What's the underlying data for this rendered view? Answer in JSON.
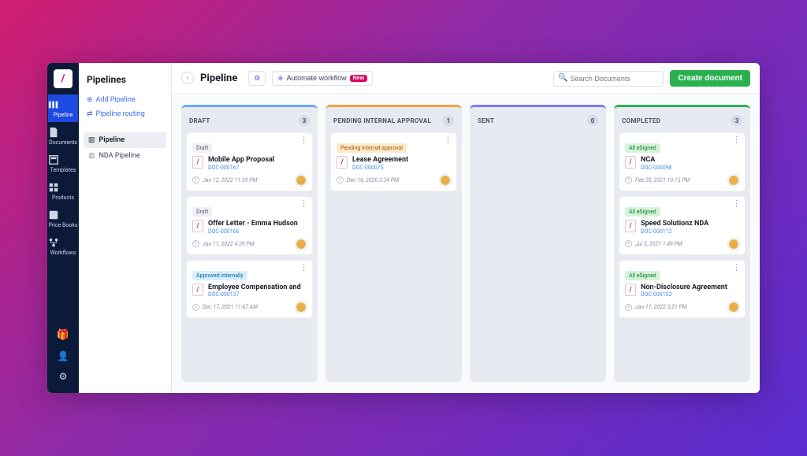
{
  "rail": {
    "items": [
      {
        "name": "pipeline",
        "label": "Pipeline",
        "active": true
      },
      {
        "name": "documents",
        "label": "Documents",
        "active": false
      },
      {
        "name": "templates",
        "label": "Templates",
        "active": false
      },
      {
        "name": "products",
        "label": "Products",
        "active": false
      },
      {
        "name": "pricebooks",
        "label": "Price Books",
        "active": false
      },
      {
        "name": "workflows",
        "label": "Workflows",
        "active": false
      }
    ]
  },
  "sidebar": {
    "title": "Pipelines",
    "links": [
      {
        "label": "Add Pipeline"
      },
      {
        "label": "Pipeline routing"
      }
    ],
    "list": [
      {
        "label": "Pipeline",
        "active": true
      },
      {
        "label": "NDA Pipeline",
        "active": false
      }
    ]
  },
  "topbar": {
    "title": "Pipeline",
    "automate_label": "Automate workflow",
    "new_pill": "New",
    "search_placeholder": "Search Documents",
    "create_label": "Create document"
  },
  "board": {
    "columns": [
      {
        "title": "DRAFT",
        "count": "3",
        "accent": "blue",
        "cards": [
          {
            "badge": "Draft",
            "badgeClass": "draft",
            "title": "Mobile App Proposal",
            "docId": "DOC-000167",
            "time": "Jan 12, 2022 11:39 PM"
          },
          {
            "badge": "Draft",
            "badgeClass": "draft",
            "title": "Offer Letter - Emma Hudson",
            "docId": "DOC-000166",
            "time": "Jan 11, 2022 4:39 PM"
          },
          {
            "badge": "Approved internally",
            "badgeClass": "approved",
            "title": "Employee Compensation and",
            "docId": "DOC-000137",
            "time": "Dec 17, 2021 11:47 AM"
          }
        ]
      },
      {
        "title": "PENDING INTERNAL APPROVAL",
        "count": "1",
        "accent": "orange",
        "cards": [
          {
            "badge": "Pending internal approval",
            "badgeClass": "pending",
            "title": "Lease Agreement",
            "docId": "DOC-000075",
            "time": "Dec 16, 2020 2:34 PM"
          }
        ]
      },
      {
        "title": "SENT",
        "count": "0",
        "accent": "purple",
        "cards": []
      },
      {
        "title": "COMPLETED",
        "count": "3",
        "accent": "green",
        "cards": [
          {
            "badge": "All eSigned",
            "badgeClass": "esigned",
            "title": "NCA",
            "docId": "DOC-000098",
            "time": "Feb 20, 2021 10:15 PM"
          },
          {
            "badge": "All eSigned",
            "badgeClass": "esigned",
            "title": "Speed Solutionz NDA",
            "docId": "DOC-000112",
            "time": "Jul 5, 2021 1:49 PM"
          },
          {
            "badge": "All eSigned",
            "badgeClass": "esigned",
            "title": "Non-Disclosure Agreement",
            "docId": "DOC-000152",
            "time": "Jan 11, 2022 3:21 PM"
          }
        ]
      }
    ]
  }
}
